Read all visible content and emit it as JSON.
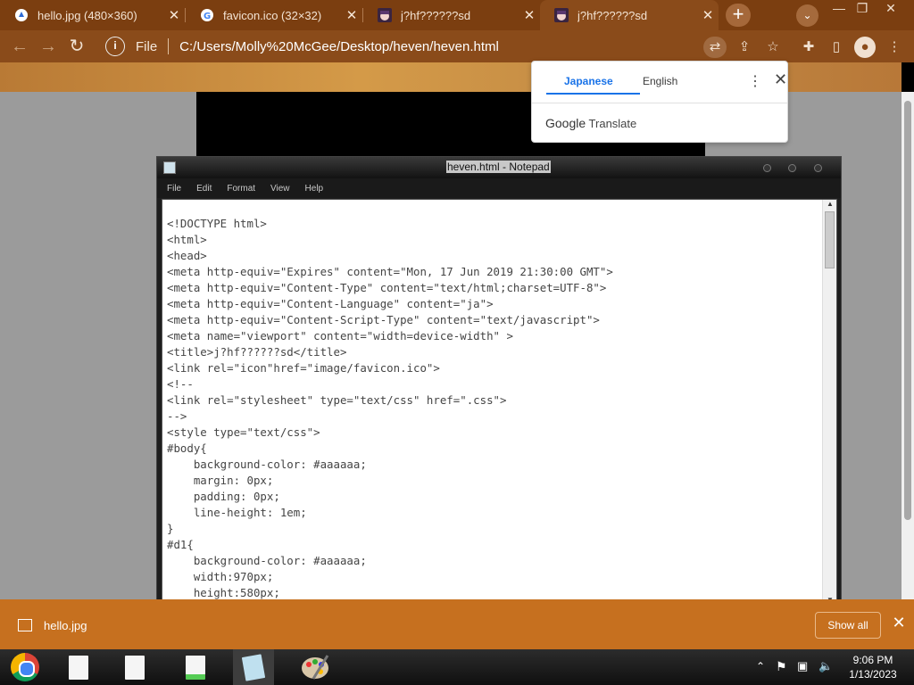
{
  "browser": {
    "tabs": [
      {
        "title": "hello.jpg (480×360)",
        "icon": "google-drive-icon"
      },
      {
        "title": "favicon.ico (32×32)",
        "icon": "google-icon"
      },
      {
        "title": "j?hf??????sd",
        "icon": "anime-avatar-icon"
      },
      {
        "title": "j?hf??????sd",
        "icon": "anime-avatar-icon"
      }
    ],
    "url_scheme_label": "File",
    "url": "C:/Users/Molly%20McGee/Desktop/heven/heven.html"
  },
  "translate": {
    "lang_source": "Japanese",
    "lang_target": "English",
    "brand_google": "Google",
    "brand_product": "Translate"
  },
  "notepad": {
    "title": "heven.html - Notepad",
    "menu": [
      "File",
      "Edit",
      "Format",
      "View",
      "Help"
    ],
    "lines": [
      "<!DOCTYPE html>",
      "<html>",
      "<head>",
      "<meta http-equiv=\"Expires\" content=\"Mon, 17 Jun 2019 21:30:00 GMT\">",
      "<meta http-equiv=\"Content-Type\" content=\"text/html;charset=UTF-8\">",
      "<meta http-equiv=\"Content-Language\" content=\"ja\">",
      "<meta http-equiv=\"Content-Script-Type\" content=\"text/javascript\">",
      "<meta name=\"viewport\" content=\"width=device-width\" >",
      "<title>j?hf??????sd</title>",
      "<link rel=\"icon\"href=\"image/favicon.ico\">",
      "<!--",
      "<link rel=\"stylesheet\" type=\"text/css\" href=\".css\">",
      "-->",
      "<style type=\"text/css\">",
      "#body{",
      "    background-color: #aaaaaa;",
      "    margin: 0px;",
      "    padding: 0px;",
      "    line-height: 1em;",
      "}",
      "#d1{",
      "    background-color: #aaaaaa;",
      "    width:970px;",
      "    height:580px;"
    ]
  },
  "download": {
    "filename": "hello.jpg",
    "show_all": "Show all"
  },
  "taskbar": {
    "time": "9:06 PM",
    "date": "1/13/2023"
  }
}
